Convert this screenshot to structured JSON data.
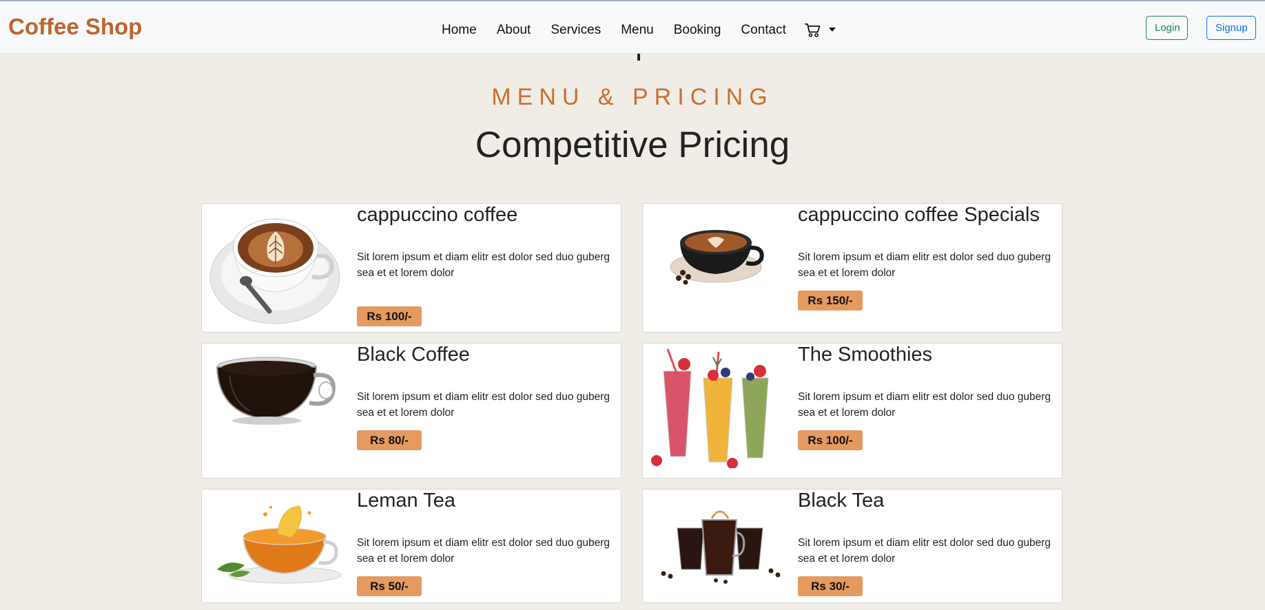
{
  "navbar": {
    "brand": "Coffee Shop",
    "links": [
      "Home",
      "About",
      "Services",
      "Menu",
      "Booking",
      "Contact"
    ],
    "cart_icon": "shopping-cart-icon",
    "login_label": "Login",
    "signup_label": "Signup"
  },
  "section": {
    "eyebrow": "MENU & PRICING",
    "heading": "Competitive Pricing"
  },
  "menu": [
    {
      "name": "cappuccino coffee",
      "description": "Sit lorem ipsum et diam elitr est dolor sed duo guberg sea et et lorem dolor",
      "price": "Rs 100/-",
      "image": "cappuccino-cup"
    },
    {
      "name": "cappuccino coffee Specials",
      "description": "Sit lorem ipsum et diam elitr est dolor sed duo guberg sea et et lorem dolor",
      "price": "Rs 150/-",
      "image": "black-cappuccino-cup"
    },
    {
      "name": "Black Coffee",
      "description": "Sit lorem ipsum et diam elitr est dolor sed duo guberg sea et et lorem dolor",
      "price": "Rs 80/-",
      "image": "glass-coffee-cup"
    },
    {
      "name": "The Smoothies",
      "description": "Sit lorem ipsum et diam elitr est dolor sed duo guberg sea et et lorem dolor",
      "price": "Rs 100/-",
      "image": "smoothie-glasses"
    },
    {
      "name": "Leman Tea",
      "description": "Sit lorem ipsum et diam elitr est dolor sed duo guberg sea et et lorem dolor",
      "price": "Rs 50/-",
      "image": "lemon-tea-cup"
    },
    {
      "name": "Black Tea",
      "description": "Sit lorem ipsum et diam elitr est dolor sed duo guberg sea et et lorem dolor",
      "price": "Rs 30/-",
      "image": "black-tea-glasses"
    }
  ],
  "colors": {
    "brand": "#c0622e",
    "accent": "#cf6d2c",
    "price_badge": "#e59a5f",
    "page_bg": "#efede6",
    "login": "#198754",
    "signup": "#0d6efd"
  }
}
